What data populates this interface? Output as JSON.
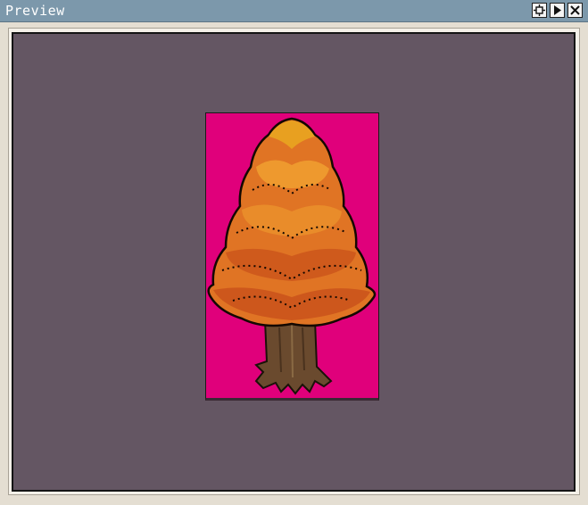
{
  "window": {
    "title": "Preview"
  },
  "titlebar_buttons": [
    {
      "name": "focus-button",
      "icon": "focus-icon"
    },
    {
      "name": "play-button",
      "icon": "play-icon"
    },
    {
      "name": "close-button",
      "icon": "close-icon"
    }
  ],
  "colors": {
    "titlebar": "#7c98ab",
    "viewport_background": "#645663",
    "sprite_background": "#e0007b",
    "foliage_dark": "#c8501a",
    "foliage_mid": "#e07424",
    "foliage_light": "#f0a030",
    "foliage_top": "#e8a020",
    "trunk": "#6a4a2e"
  },
  "sprite": {
    "subject": "autumn-tree"
  }
}
